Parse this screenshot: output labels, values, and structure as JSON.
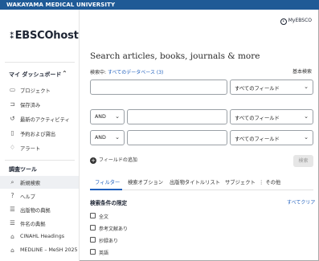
{
  "institution": "WAKAYAMA MEDICAL UNIVERSITY",
  "brand": {
    "logo_text": "EBSCOhost"
  },
  "account": {
    "label": "MyEBSCO"
  },
  "sidebar": {
    "dashboard_heading": "マイ ダッシュボード",
    "dashboard_items": [
      {
        "label": "プロジェクト",
        "icon": "folder-icon"
      },
      {
        "label": "保存済み",
        "icon": "bookmark-icon"
      },
      {
        "label": "最新のアクティビティ",
        "icon": "history-icon"
      },
      {
        "label": "予約および貸出",
        "icon": "book-icon"
      },
      {
        "label": "アラート",
        "icon": "bell-icon"
      }
    ],
    "tools_heading": "調査ツール",
    "tools_items": [
      {
        "label": "新規検索",
        "icon": "search-icon"
      },
      {
        "label": "ヘルプ",
        "icon": "help-icon"
      },
      {
        "label": "出版物の典拠",
        "icon": "list-icon"
      },
      {
        "label": "件名の典拠",
        "icon": "list-icon"
      },
      {
        "label": "CINAHL Headings",
        "icon": "institution-icon"
      },
      {
        "label": "MEDLINE – MeSH 2025",
        "icon": "institution-icon"
      }
    ]
  },
  "main": {
    "title": "Search articles, books, journals & more",
    "search_in_label": "検索中:",
    "database_link": "すべてのデータベース (3)",
    "basic_search_link": "基本検索",
    "rows": [
      {
        "field": "すべてのフィールド",
        "value": ""
      },
      {
        "operator": "AND",
        "field": "すべてのフィールド",
        "value": ""
      },
      {
        "operator": "AND",
        "field": "すべてのフィールド",
        "value": ""
      }
    ],
    "add_field_label": "フィールドの追加",
    "search_button": "検索",
    "tabs": [
      "フィルター",
      "検索オプション",
      "出版物タイトルリスト",
      "サブジェクト",
      "その他"
    ],
    "active_tab": "フィルター",
    "limits_heading": "検索条件の限定",
    "clear_all": "すべてクリア",
    "limit_options": [
      "全文",
      "参考文献あり",
      "抄録あり",
      "英語",
      "要旨"
    ]
  },
  "colors": {
    "topbar": "#1f5a96",
    "link": "#1f5fbd",
    "accent": "#1f5fbd"
  }
}
